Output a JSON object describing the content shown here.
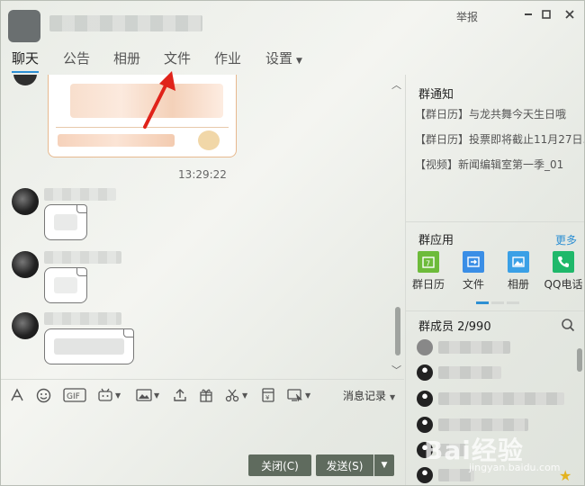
{
  "window": {
    "report_label": "举报",
    "minimize_icon": "minimize-icon",
    "maximize_icon": "maximize-icon",
    "close_icon": "close-icon"
  },
  "tabs": [
    {
      "label": "聊天",
      "active": true
    },
    {
      "label": "公告"
    },
    {
      "label": "相册"
    },
    {
      "label": "文件"
    },
    {
      "label": "作业"
    },
    {
      "label": "设置",
      "has_dropdown": true
    }
  ],
  "chat": {
    "timestamp": "13:29:22"
  },
  "toolbar": {
    "tools": [
      "font-icon",
      "emoji-icon",
      "gif-icon",
      "magic-face-icon",
      "image-icon",
      "upload-icon",
      "gift-icon",
      "screenshot-icon",
      "red-packet-icon",
      "remote-assist-icon"
    ],
    "history_label": "消息记录"
  },
  "buttons": {
    "close_label": "关闭(C)",
    "send_label": "发送(S)"
  },
  "right": {
    "notice_title": "群通知",
    "notices": [
      "【群日历】与龙共舞今天生日哦",
      "【群日历】投票即将截止11月27日...",
      "【视频】新闻编辑室第一季_01"
    ],
    "apps_title": "群应用",
    "more_label": "更多",
    "apps": [
      {
        "label": "群日历",
        "icon": "calendar-icon",
        "color": "#6dbb3a"
      },
      {
        "label": "文件",
        "icon": "file-icon",
        "color": "#3a8ee6"
      },
      {
        "label": "相册",
        "icon": "album-icon",
        "color": "#3aa0e6"
      },
      {
        "label": "QQ电话",
        "icon": "phone-icon",
        "color": "#1fb86a"
      }
    ],
    "members_title": "群成员 2/990"
  },
  "watermark": {
    "brand": "Bai经验",
    "url": "jingyan.baidu.com"
  }
}
